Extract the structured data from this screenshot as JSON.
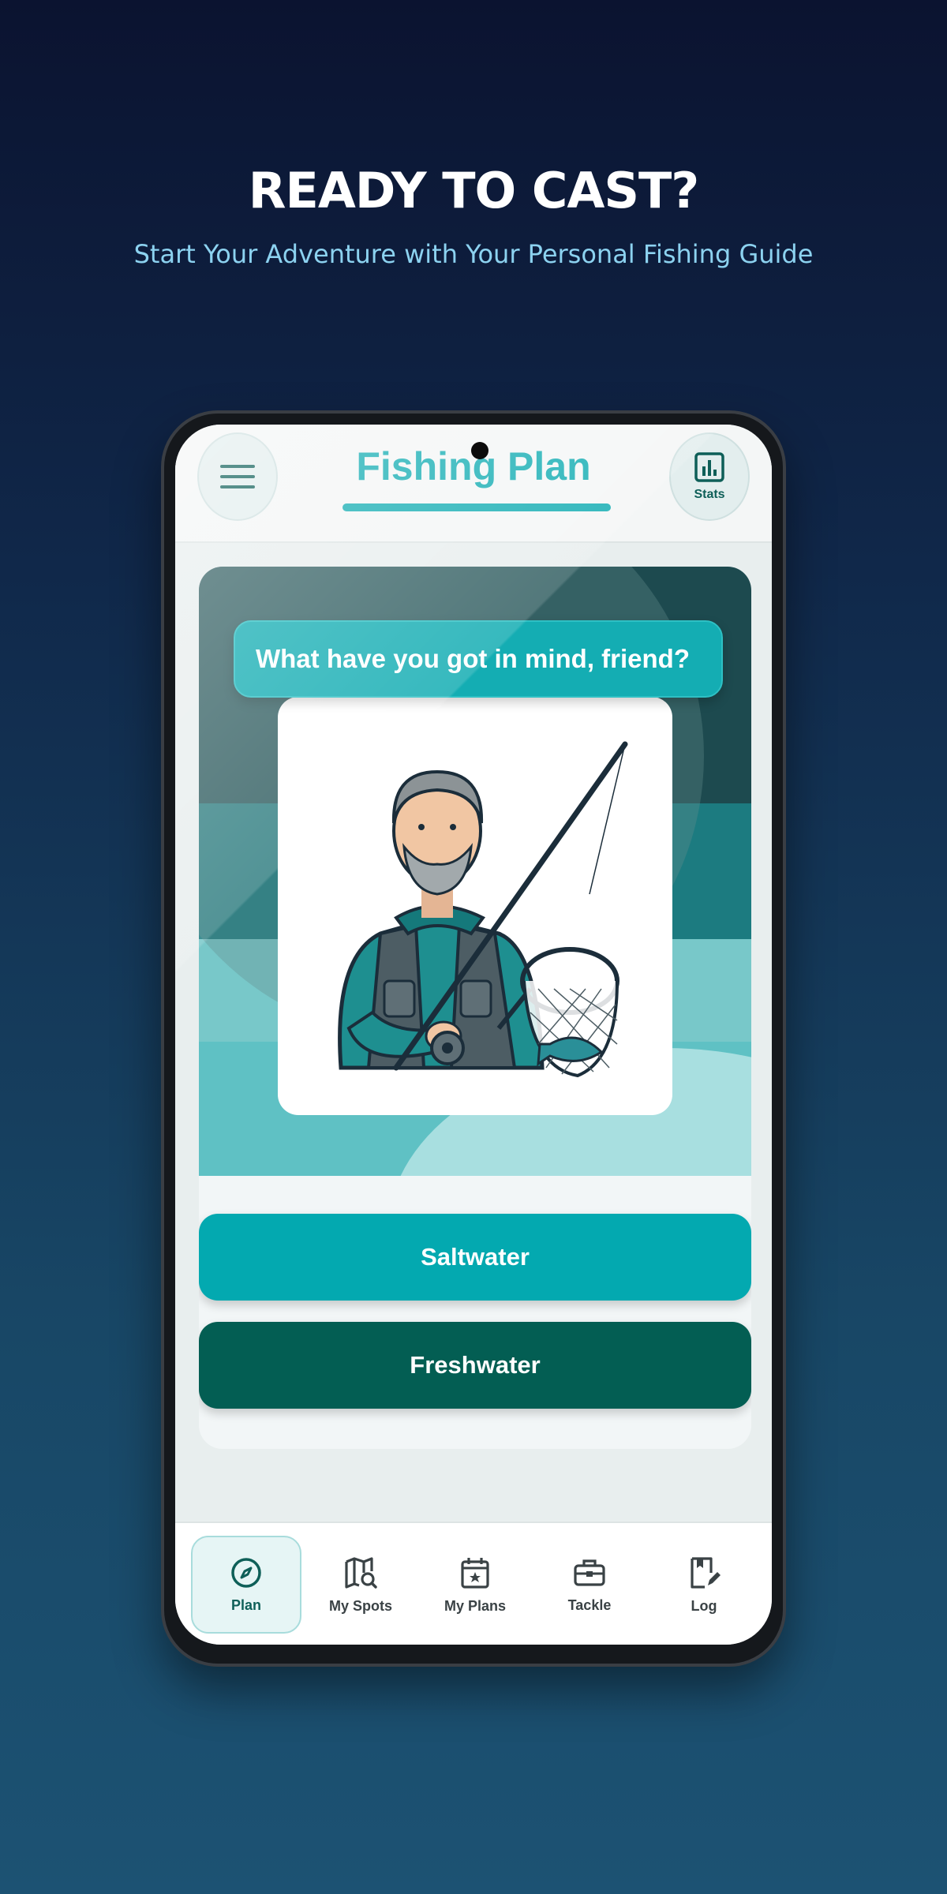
{
  "hero": {
    "title": "READY TO CAST?",
    "subtitle": "Start Your Adventure with Your Personal Fishing Guide"
  },
  "header": {
    "title": "Fishing Plan",
    "menu_icon": "hamburger-menu-icon",
    "stats_icon": "bar-chart-icon",
    "stats_label": "Stats"
  },
  "prompt": {
    "question": "What have you got in mind, friend?"
  },
  "choices": {
    "saltwater_label": "Saltwater",
    "freshwater_label": "Freshwater"
  },
  "nav": {
    "items": [
      {
        "label": "Plan",
        "icon": "compass-icon",
        "active": true
      },
      {
        "label": "My Spots",
        "icon": "map-search-icon",
        "active": false
      },
      {
        "label": "My Plans",
        "icon": "calendar-star-icon",
        "active": false
      },
      {
        "label": "Tackle",
        "icon": "tackle-box-icon",
        "active": false
      },
      {
        "label": "Log",
        "icon": "journal-edit-icon",
        "active": false
      }
    ]
  },
  "colors": {
    "accent": "#14adb3",
    "saltwater": "#03a9b0",
    "freshwater": "#035e53",
    "hero_subtitle": "#8cd2f0",
    "dark_teal": "#0e5f58"
  }
}
